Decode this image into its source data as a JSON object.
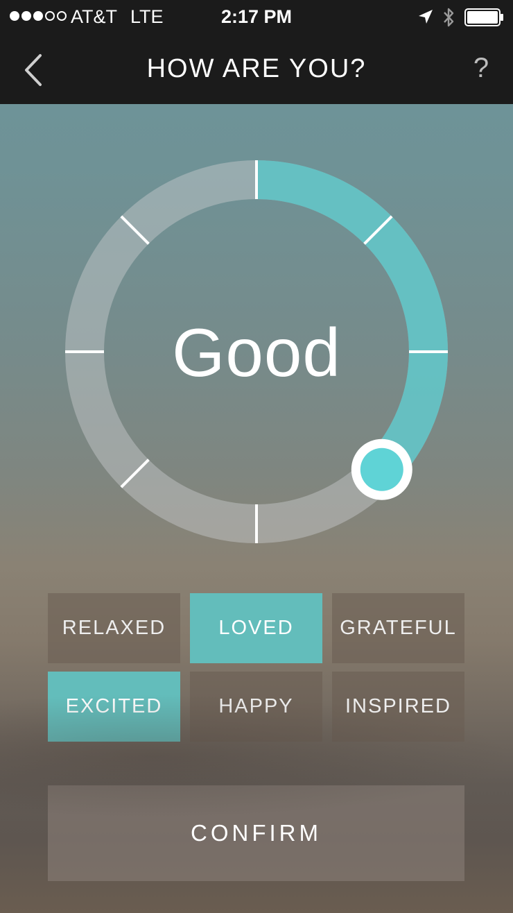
{
  "status_bar": {
    "signal_icon": "signal-dots-icon",
    "carrier": "AT&T",
    "network": "LTE",
    "time": "2:17 PM",
    "location_icon": "location-arrow-icon",
    "bluetooth_icon": "bluetooth-icon",
    "battery_icon": "battery-icon"
  },
  "nav": {
    "back_icon": "chevron-left-icon",
    "title": "HOW ARE YOU?",
    "help": "?"
  },
  "dial": {
    "mood": "Good",
    "level": 0.37,
    "segments": 8,
    "accent_color": "#5fc2c4",
    "track_color": "#c9cdcf"
  },
  "moods": [
    {
      "label": "RELAXED",
      "selected": false
    },
    {
      "label": "LOVED",
      "selected": true
    },
    {
      "label": "GRATEFUL",
      "selected": false
    },
    {
      "label": "EXCITED",
      "selected": true
    },
    {
      "label": "HAPPY",
      "selected": false
    },
    {
      "label": "INSPIRED",
      "selected": false
    }
  ],
  "confirm_label": "CONFIRM",
  "colors": {
    "accent": "#63bdbb",
    "bar_background": "#1b1b1b"
  }
}
